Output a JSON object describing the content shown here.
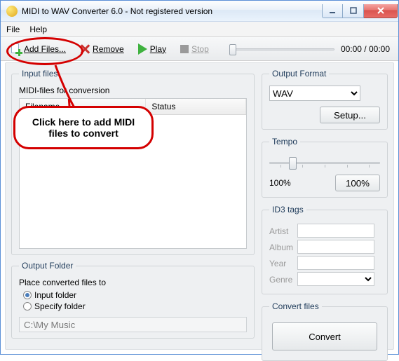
{
  "window": {
    "title": "MIDI to WAV Converter 6.0 - Not registered version"
  },
  "menu": {
    "file": "File",
    "help": "Help"
  },
  "toolbar": {
    "add_label": "Add Files...",
    "remove_label": "Remove",
    "play_label": "Play",
    "stop_label": "Stop",
    "time": "00:00 / 00:00"
  },
  "input": {
    "legend": "Input files",
    "subtext": "MIDI-files for conversion",
    "col_filename": "Filename",
    "col_status": "Status"
  },
  "callout": {
    "text": "Click here to add MIDI files to convert"
  },
  "output_folder": {
    "legend": "Output Folder",
    "subtext": "Place converted files to",
    "opt_input": "Input folder",
    "opt_specify": "Specify folder",
    "selected": "input",
    "path_value": "C:\\My Music"
  },
  "output_format": {
    "legend": "Output Format",
    "options": [
      "WAV"
    ],
    "selected": "WAV",
    "setup_label": "Setup..."
  },
  "tempo": {
    "legend": "Tempo",
    "left_label": "100%",
    "reset_label": "100%"
  },
  "id3": {
    "legend": "ID3 tags",
    "artist_lbl": "Artist",
    "artist": "",
    "album_lbl": "Album",
    "album": "",
    "year_lbl": "Year",
    "year": "",
    "genre_lbl": "Genre",
    "genre": ""
  },
  "convert": {
    "legend": "Convert files",
    "button": "Convert"
  }
}
